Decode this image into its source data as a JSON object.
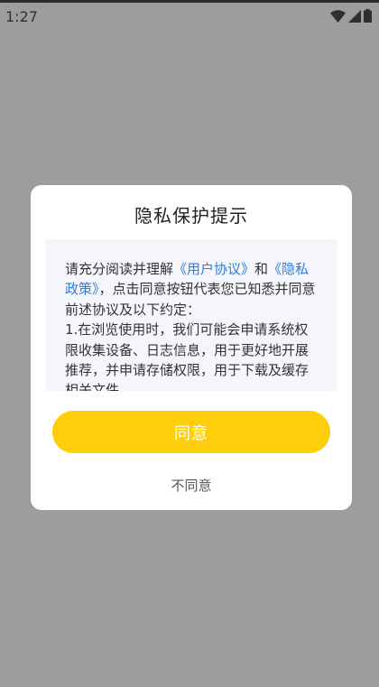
{
  "status_bar": {
    "time": "1:27",
    "icons": [
      "wifi-icon",
      "cellular-signal-icon",
      "battery-icon"
    ]
  },
  "dialog": {
    "title": "隐私保护提示",
    "content": {
      "intro": "请充分阅读并理解",
      "link_user_agreement": "《用户协议》",
      "and": "和",
      "link_privacy_policy": "《隐私政策》",
      "after_links": "，点击同意按钮代表您已知悉并同意前述协议及以下约定：",
      "item1": "1.在浏览使用时，我们可能会申请系统权限收集设备、日志信息，用于更好地开展推荐，并申请存储权限，用于下载及缓存相关文件。"
    },
    "agree_label": "同意",
    "disagree_label": "不同意"
  },
  "colors": {
    "overlay_background": "#9e9d9e",
    "dialog_background": "#ffffff",
    "content_background": "#f4f6fb",
    "link": "#2d7de0",
    "agree_button": "#fecd0b"
  }
}
